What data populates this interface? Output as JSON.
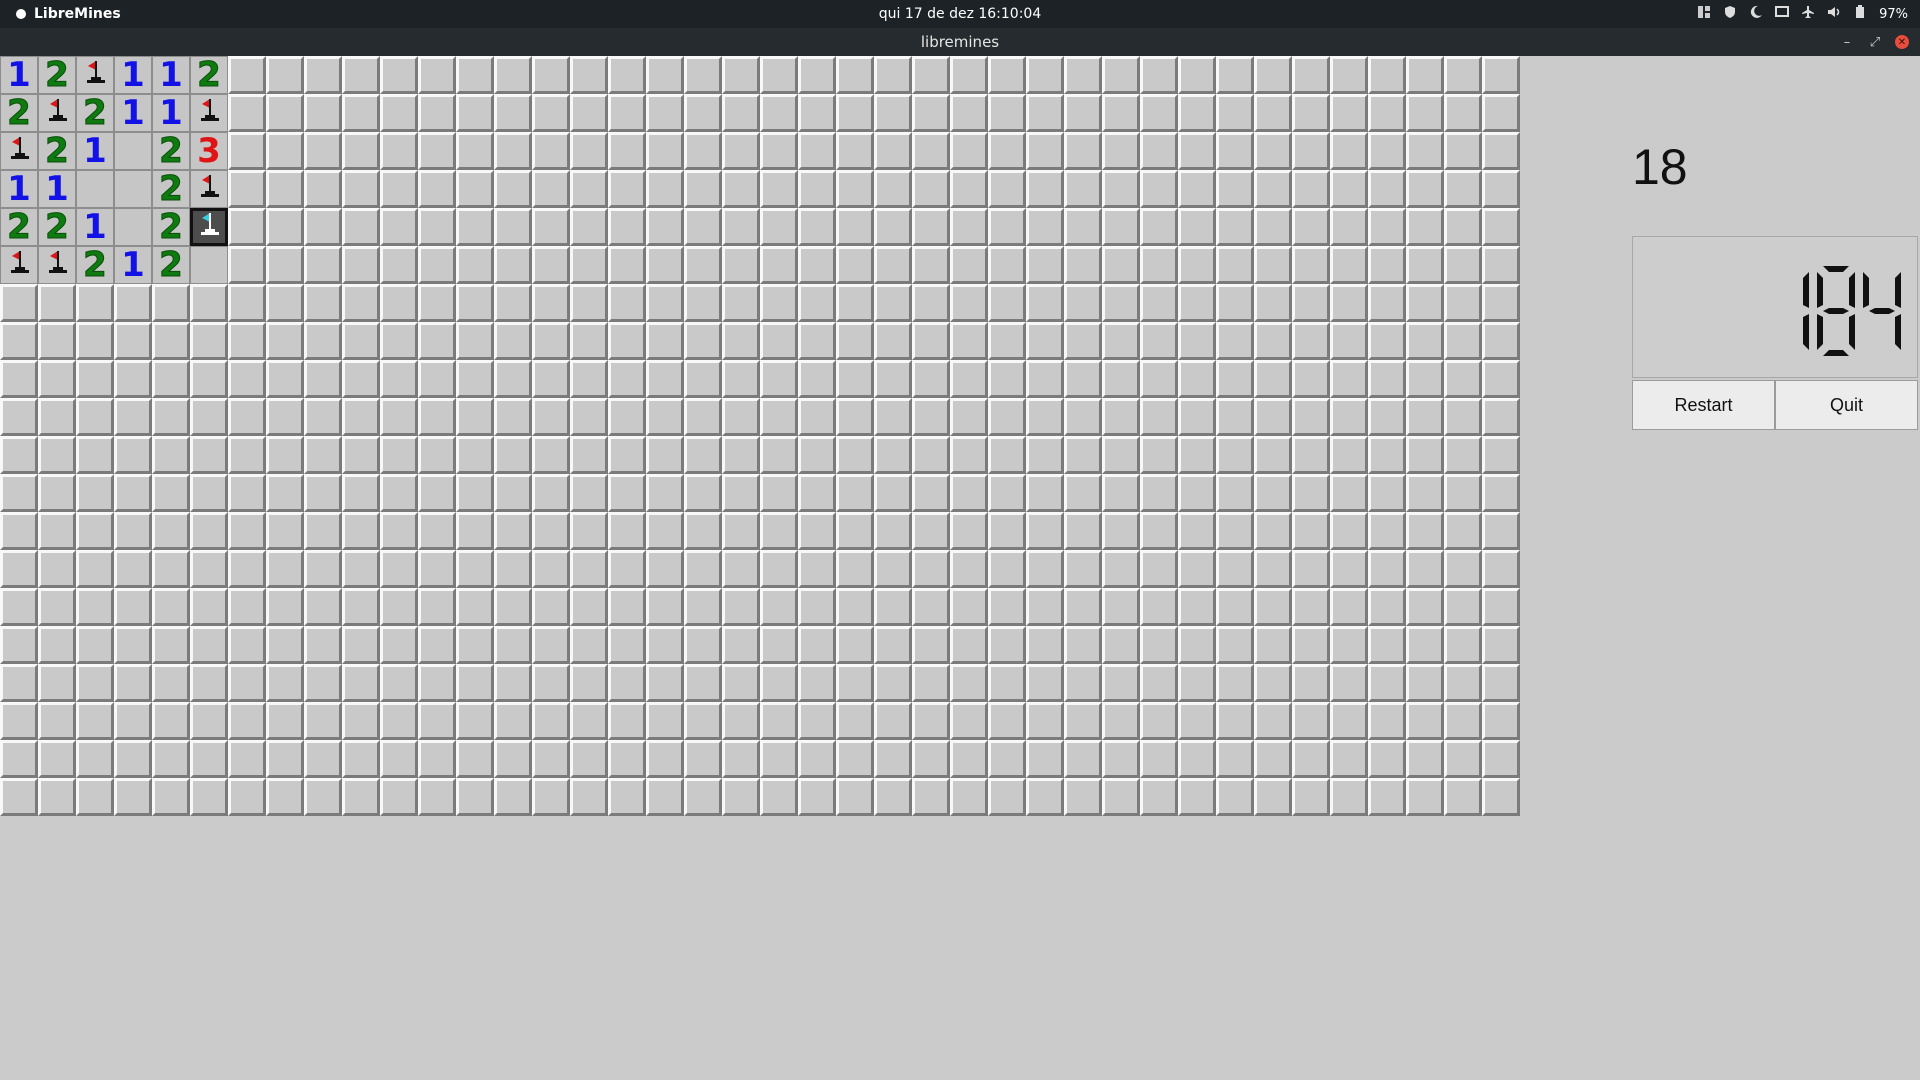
{
  "topbar": {
    "app_name": "LibreMines",
    "clock": "qui 17 de dez  16:10:04",
    "battery": "97%"
  },
  "window": {
    "title": "libremines"
  },
  "board": {
    "cols": 40,
    "rows": 20,
    "revealed": [
      [
        "1",
        "2",
        "F",
        "1",
        "1",
        "2"
      ],
      [
        "2",
        "F",
        "2",
        "1",
        "1",
        "F"
      ],
      [
        "F",
        "2",
        "1",
        "",
        "2",
        "3"
      ],
      [
        "1",
        "1",
        "",
        "",
        "2",
        "F"
      ],
      [
        "2",
        "2",
        "1",
        "",
        "2",
        "S"
      ],
      [
        "F",
        "F",
        "2",
        "1",
        "2",
        ""
      ]
    ]
  },
  "panel": {
    "mines_left": "18",
    "timer": "184",
    "restart_label": "Restart",
    "quit_label": "Quit"
  },
  "colors": {
    "one": "#1212e6",
    "two": "#0f7a0f",
    "three": "#e01414",
    "tile": "#c9c9c9",
    "bg": "#cbcbcb"
  }
}
